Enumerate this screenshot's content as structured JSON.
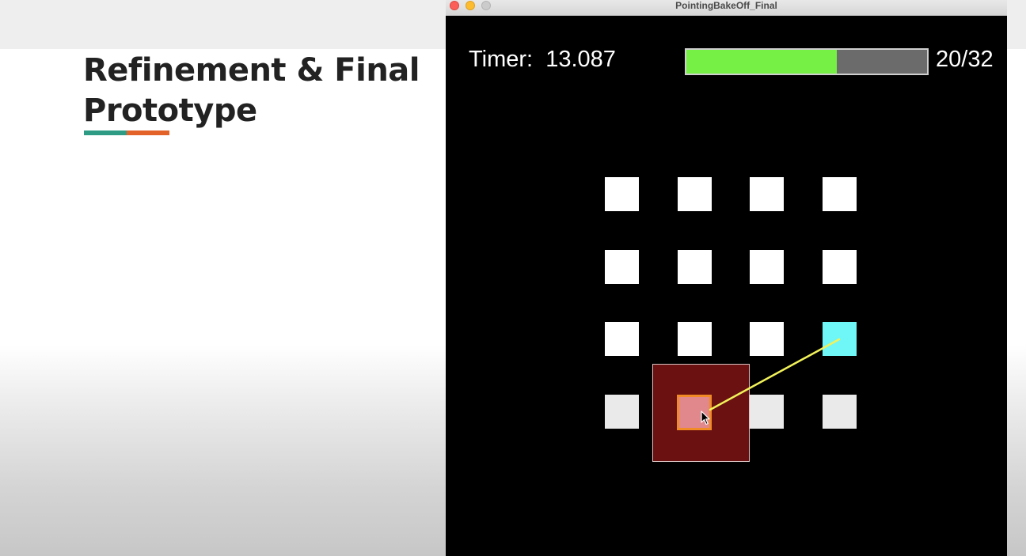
{
  "slide": {
    "title": "Refinement & Final Prototype",
    "accent_colors": [
      "#2e9c84",
      "#e2622a"
    ]
  },
  "window": {
    "title": "PointingBakeOff_Final",
    "traffic_lights": [
      "close",
      "minimize",
      "maximize"
    ]
  },
  "hud": {
    "timer_label": "Timer:  13.087",
    "progress_text": "20/32",
    "progress_fraction": 0.625,
    "progress_fill_color": "#77f046",
    "progress_track_color": "#6b6b6b"
  },
  "grid": {
    "rows": 4,
    "columns": 4,
    "tile_color": "#ffffff",
    "target_tile": {
      "row": 3,
      "column": 4,
      "color": "#6ff6f6"
    },
    "selected_tile": {
      "row": 4,
      "column": 2,
      "color": "#e0888c",
      "border_color": "#f08b26"
    },
    "cursor_zone_color": "#6b1111",
    "guide_line_color": "#f2f25a"
  }
}
